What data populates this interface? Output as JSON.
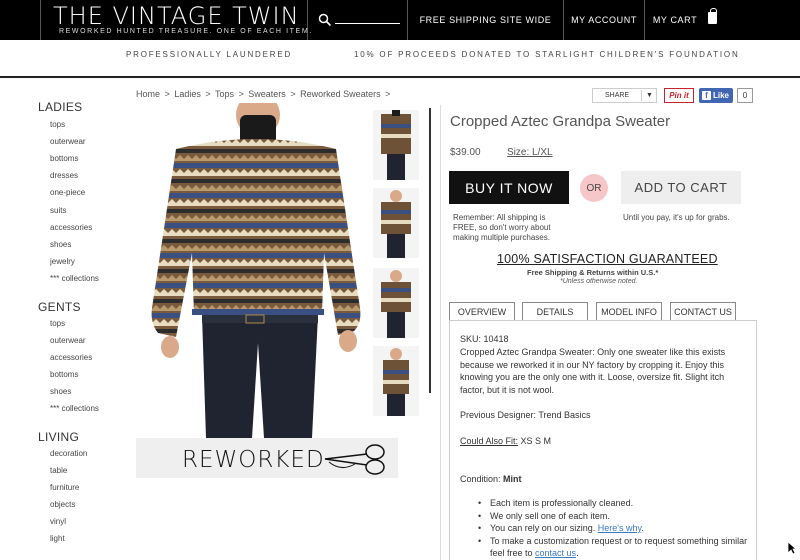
{
  "header": {
    "logo_title": "THE VINTAGE TWIN",
    "logo_tagline": "REWORKED HUNTED TREASURE. ONE OF EACH ITEM.",
    "free_shipping": "FREE SHIPPING SITE WIDE",
    "my_account": "MY ACCOUNT",
    "my_cart": "MY CART"
  },
  "promo": {
    "left": "PROFESSIONALLY LAUNDERED",
    "right": "10% OF PROCEEDS DONATED TO STARLIGHT CHILDREN'S FOUNDATION"
  },
  "sidebar": {
    "ladies": {
      "heading": "LADIES",
      "items": [
        "tops",
        "outerwear",
        "bottoms",
        "dresses",
        "one-piece",
        "suits",
        "accessories",
        "shoes",
        "jewelry",
        "*** collections"
      ]
    },
    "gents": {
      "heading": "GENTS",
      "items": [
        "tops",
        "outerwear",
        "accessories",
        "bottoms",
        "shoes",
        "*** collections"
      ]
    },
    "living": {
      "heading": "LIVING",
      "items": [
        "decoration",
        "table",
        "furniture",
        "objects",
        "vinyl",
        "light"
      ]
    }
  },
  "breadcrumb": [
    "Home",
    ">",
    "Ladies",
    ">",
    "Tops",
    ">",
    "Sweaters",
    ">",
    "Reworked Sweaters",
    ">"
  ],
  "share": {
    "label": "SHARE",
    "caret": "▼",
    "pinit": "Pin it",
    "fb_like": "Like",
    "fb_count": "0"
  },
  "reworked_banner": "REWORKED",
  "product": {
    "title": "Cropped Aztec Grandpa Sweater",
    "price": "$39.00",
    "size": "Size: L/XL",
    "buy_now": "BUY IT NOW",
    "or": "OR",
    "add_to_cart": "ADD TO CART",
    "buy_note": "Remember: All shipping is FREE, so don't worry about making multiple purchases.",
    "cart_note": "Until you pay, it's up for grabs.",
    "guarantee": "100% SATISFACTION GUARANTEED",
    "free_shipping_returns": "Free Shipping & Returns within U.S.*",
    "unless": "*Unless otherwise noted."
  },
  "tabs": [
    "OVERVIEW",
    "DETAILS",
    "MODEL INFO",
    "CONTACT US"
  ],
  "overview": {
    "sku": "SKU: 10418",
    "description": "Cropped Aztec Grandpa Sweater: Only one sweater like this exists because we reworked it in our NY factory by cropping it. Enjoy this knowing you are the only one with it. Loose, oversize fit. Slight itch factor, but it is not wool.",
    "previous_designer": "Previous Designer: Trend Basics",
    "could_also_fit_label": "Could Also Fit:",
    "could_also_fit_value": " XS S M",
    "condition_label": "Condition: ",
    "condition_value": "Mint",
    "bullet_1": "Each item is professionally cleaned.",
    "bullet_2": "We only sell one of each item.",
    "bullet_3_text": "You can rely on our sizing. ",
    "bullet_3_link": "Here's why",
    "bullet_3_end": ".",
    "bullet_4_text": "To make a customization request or to request something similar feel free to ",
    "bullet_4_link": "contact us",
    "bullet_4_end": "."
  },
  "colors": {
    "header_bg": "#000000",
    "buy_button": "#111111",
    "or_badge": "#f7c7c7",
    "link": "#3b78c4",
    "pinterest": "#c8232c",
    "facebook": "#4267b2"
  }
}
